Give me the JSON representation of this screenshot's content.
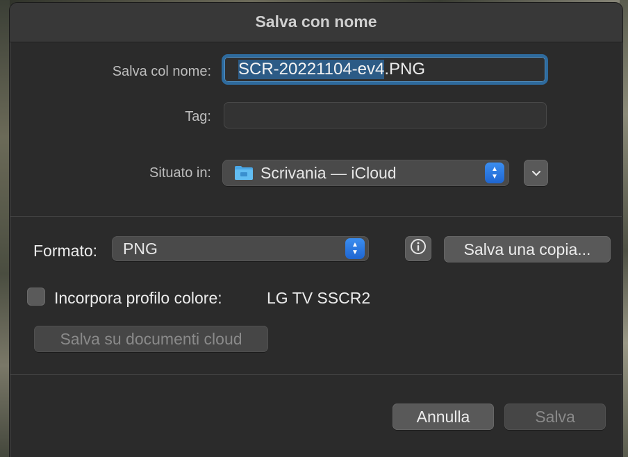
{
  "dialog": {
    "title": "Salva con nome"
  },
  "fields": {
    "name_label": "Salva col nome:",
    "name_selected": "SCR-20221104-ev4",
    "name_ext": ".PNG",
    "tag_label": "Tag:",
    "location_label": "Situato in:",
    "location_value": "Scrivania — iCloud"
  },
  "options": {
    "format_label": "Formato:",
    "format_value": "PNG",
    "save_copy_label": "Salva una copia...",
    "embed_profile_label": "Incorpora profilo colore:",
    "profile_value": "LG TV SSCR2",
    "cloud_docs_label": "Salva su documenti cloud"
  },
  "footer": {
    "cancel_label": "Annulla",
    "save_label": "Salva"
  },
  "colors": {
    "accent": "#2e6b9e",
    "stepper": "#1f66d1",
    "background": "#2b2b2b"
  }
}
